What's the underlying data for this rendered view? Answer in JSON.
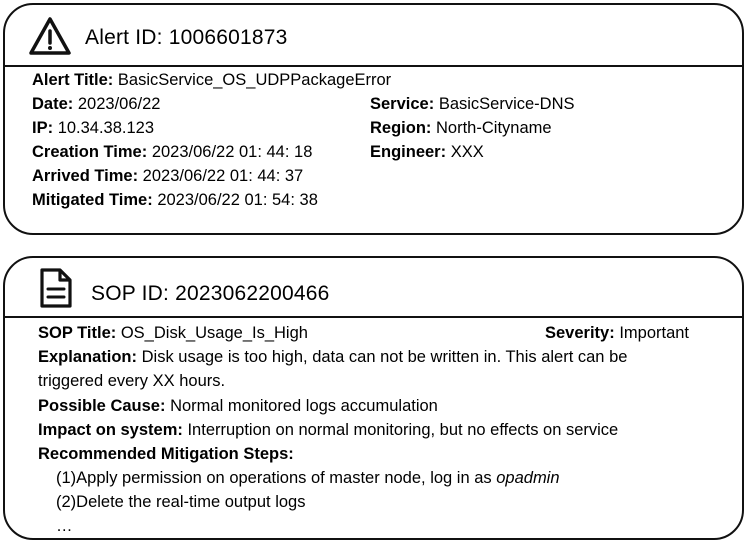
{
  "alert": {
    "title_label": "Alert ID:",
    "title_value": "1006601873",
    "icon": "warning-icon",
    "fields_left": [
      {
        "label": "Alert Title:",
        "value": "BasicService_OS_UDPPackageError"
      },
      {
        "label": "Date:",
        "value": "2023/06/22"
      },
      {
        "label": "IP:",
        "value": "10.34.38.123"
      },
      {
        "label": "Creation Time:",
        "value": "2023/06/22 01: 44: 18"
      },
      {
        "label": "Arrived Time:",
        "value": "2023/06/22 01: 44: 37"
      },
      {
        "label": "Mitigated Time:",
        "value": "2023/06/22 01: 54: 38"
      }
    ],
    "fields_right": [
      {
        "label": "Service:",
        "value": "BasicService-DNS"
      },
      {
        "label": "Region:",
        "value": "North-Cityname"
      },
      {
        "label": "Engineer:",
        "value": "XXX"
      }
    ]
  },
  "sop": {
    "title_label": "SOP ID:",
    "title_value": "2023062200466",
    "icon": "document-icon",
    "sop_title_label": "SOP Title:",
    "sop_title_value": "OS_Disk_Usage_Is_High",
    "severity_label": "Severity:",
    "severity_value": "Important",
    "explanation_label": "Explanation:",
    "explanation_line1": "Disk usage is too high, data can not be written in. This alert can be",
    "explanation_line2": "triggered every XX hours.",
    "cause_label": "Possible Cause:",
    "cause_value": "Normal monitored logs accumulation",
    "impact_label": "Impact on system:",
    "impact_value": "Interruption on normal monitoring, but no effects on service",
    "steps_label": "Recommended Mitigation Steps:",
    "step1_text": "(1)Apply permission on operations of master node, log in as ",
    "step1_italic": "opadmin",
    "step2_text": "(2)Delete the real-time output logs",
    "ellipsis": "…"
  }
}
